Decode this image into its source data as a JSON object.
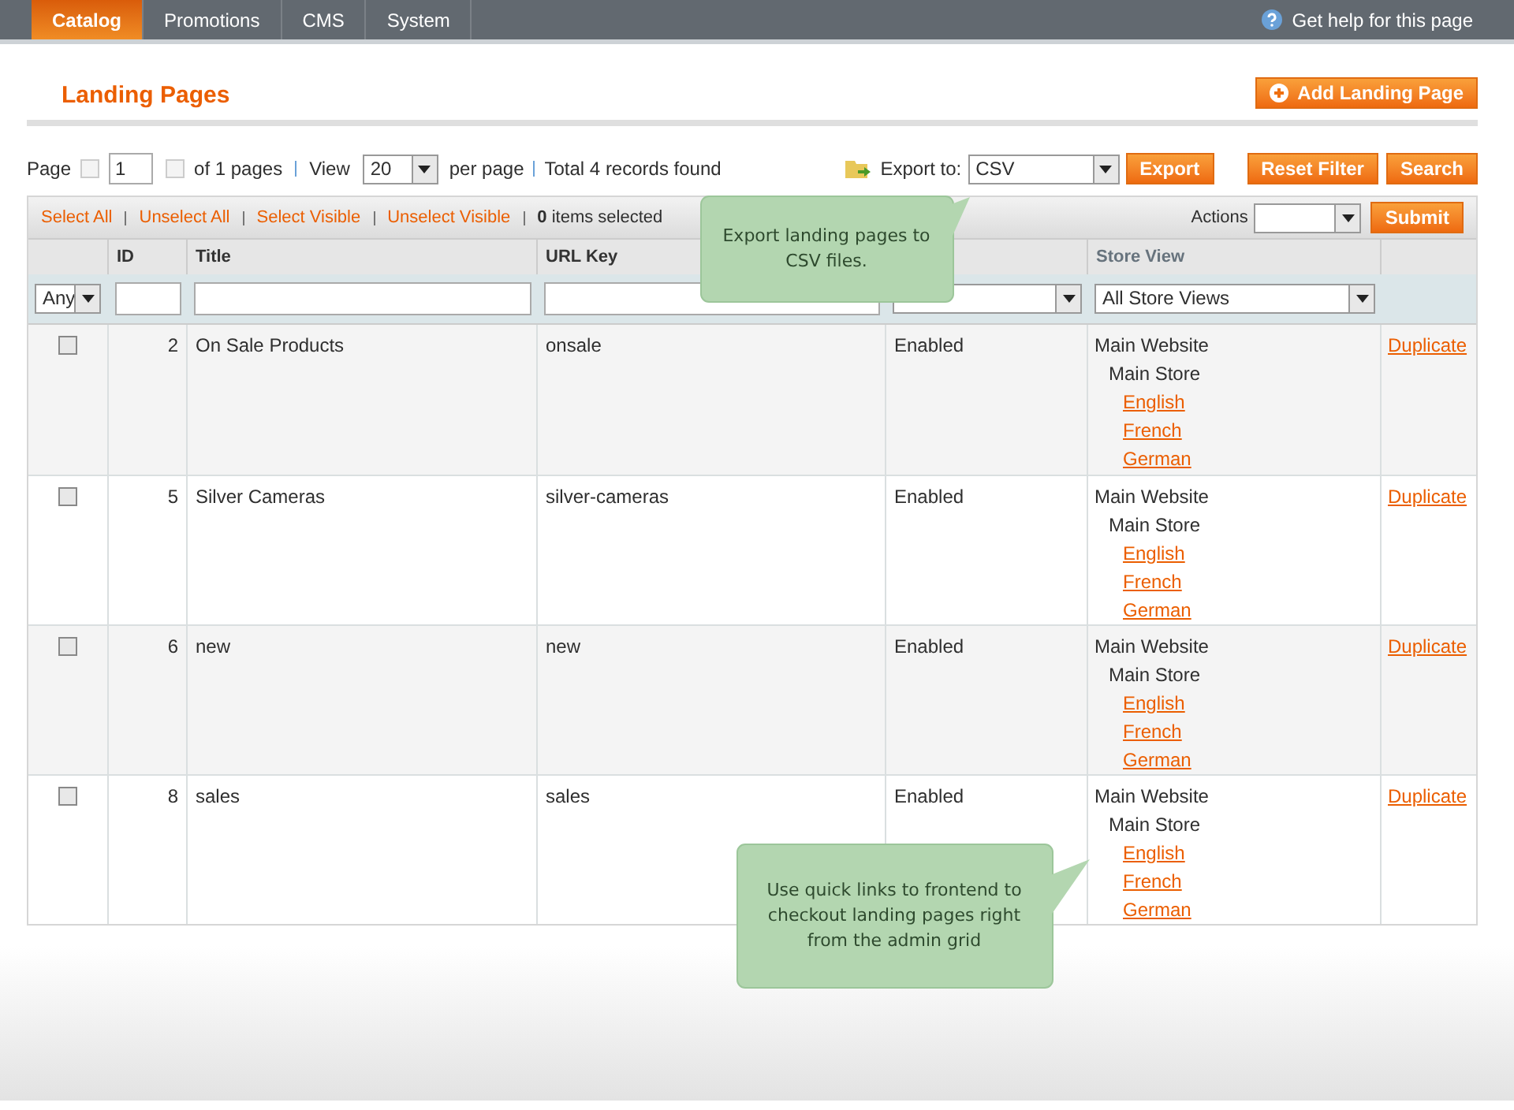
{
  "nav": {
    "tabs": [
      {
        "label": "Catalog",
        "selected": true
      },
      {
        "label": "Promotions",
        "selected": false
      },
      {
        "label": "CMS",
        "selected": false
      },
      {
        "label": "System",
        "selected": false
      }
    ],
    "help": "Get help for this page"
  },
  "page_title": "Landing Pages",
  "add_button": "Add Landing Page",
  "pager": {
    "page_label": "Page",
    "page": "1",
    "of_pages": "of 1 pages",
    "view_label": "View",
    "per_page": "20",
    "per_page_label": "per page",
    "total": "Total 4 records found",
    "export_label": "Export to:",
    "export_format": "CSV",
    "export_button": "Export",
    "reset_button": "Reset Filter",
    "search_button": "Search"
  },
  "massaction": {
    "links": [
      "Select All",
      "Unselect All",
      "Select Visible",
      "Unselect Visible"
    ],
    "count": "0",
    "count_label": "items selected",
    "actions_label": "Actions",
    "submit": "Submit"
  },
  "table": {
    "columns": [
      "ID",
      "Title",
      "URL Key",
      "Store View"
    ],
    "filters": {
      "any": "Any",
      "store_view": "All Store Views"
    },
    "rows": [
      {
        "checked": false,
        "id": "2",
        "title": "On Sale Products",
        "url_key": "onsale",
        "status": "Enabled",
        "website": "Main Website",
        "store": "Main Store",
        "views": [
          "English",
          "French",
          "German"
        ],
        "action": "Duplicate"
      },
      {
        "checked": false,
        "id": "5",
        "title": "Silver Cameras",
        "url_key": "silver-cameras",
        "status": "Enabled",
        "website": "Main Website",
        "store": "Main Store",
        "views": [
          "English",
          "French",
          "German"
        ],
        "action": "Duplicate"
      },
      {
        "checked": false,
        "id": "6",
        "title": "new",
        "url_key": "new",
        "status": "Enabled",
        "website": "Main Website",
        "store": "Main Store",
        "views": [
          "English",
          "French",
          "German"
        ],
        "action": "Duplicate"
      },
      {
        "checked": false,
        "id": "8",
        "title": "sales",
        "url_key": "sales",
        "status": "Enabled",
        "website": "Main Website",
        "store": "Main Store",
        "views": [
          "English",
          "French",
          "German"
        ],
        "action": "Duplicate"
      }
    ]
  },
  "callouts": [
    {
      "text": "Export landing pages to CSV files.",
      "kind": "up"
    },
    {
      "text": "Use quick links to frontend to checkout landing pages right from the admin grid",
      "kind": "right"
    }
  ]
}
